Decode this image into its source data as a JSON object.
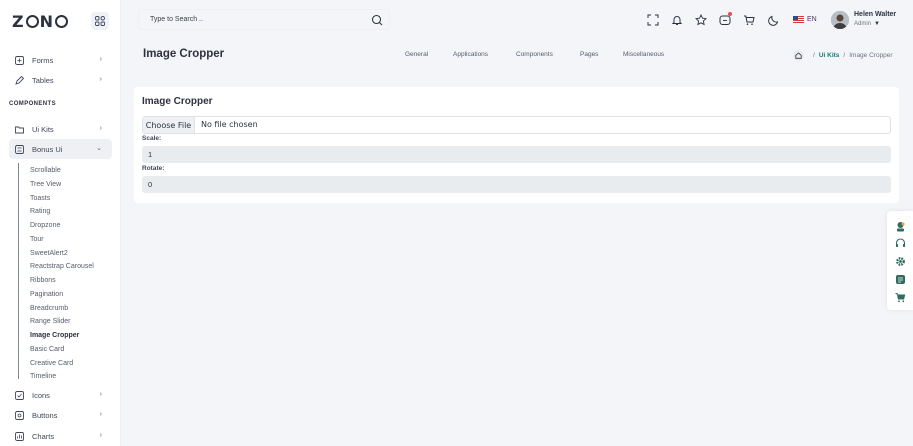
{
  "brand": {
    "logo_text": [
      "Z",
      "N",
      "O"
    ]
  },
  "sidebar": {
    "items_top": [
      {
        "label": "Forms",
        "icon": "form-icon"
      },
      {
        "label": "Tables",
        "icon": "edit-icon"
      }
    ],
    "section_title": "COMPONENTS",
    "items_mid": [
      {
        "label": "Ui Kits",
        "icon": "folder-icon"
      },
      {
        "label": "Bonus Ui",
        "icon": "layers-icon"
      }
    ],
    "bonus_ui_items": [
      "Scrollable",
      "Tree View",
      "Toasts",
      "Rating",
      "Dropzone",
      "Tour",
      "SweetAlert2",
      "Reactstrap Carousel",
      "Ribbons",
      "Pagination",
      "Breadcrumb",
      "Range Slider",
      "Image Cropper",
      "Basic Card",
      "Creative Card",
      "Timeline"
    ],
    "current_item": "Image Cropper",
    "items_bottom": [
      {
        "label": "Icons",
        "icon": "icons-icon"
      },
      {
        "label": "Buttons",
        "icon": "button-icon"
      },
      {
        "label": "Charts",
        "icon": "chart-icon"
      }
    ]
  },
  "header": {
    "search_placeholder": "Type to Search ..",
    "language": "EN",
    "user": {
      "name": "Helen Walter",
      "role": "Admin"
    }
  },
  "page": {
    "title": "Image Cropper",
    "nav": [
      "General",
      "Applications",
      "Components",
      "Pages",
      "Miscellaneous"
    ],
    "breadcrumb": {
      "section": "Ui Kits",
      "current": "Image Cropper"
    }
  },
  "card": {
    "title": "Image Cropper",
    "file_button": "Choose File",
    "file_status": "No file chosen",
    "scale_label": "Scale:",
    "scale_value": "1",
    "rotate_label": "Rotate:",
    "rotate_value": "0"
  },
  "colors": {
    "accent": "#0f7a75",
    "sidebar_bg": "#ffffff",
    "page_bg": "#f4f5f8"
  }
}
